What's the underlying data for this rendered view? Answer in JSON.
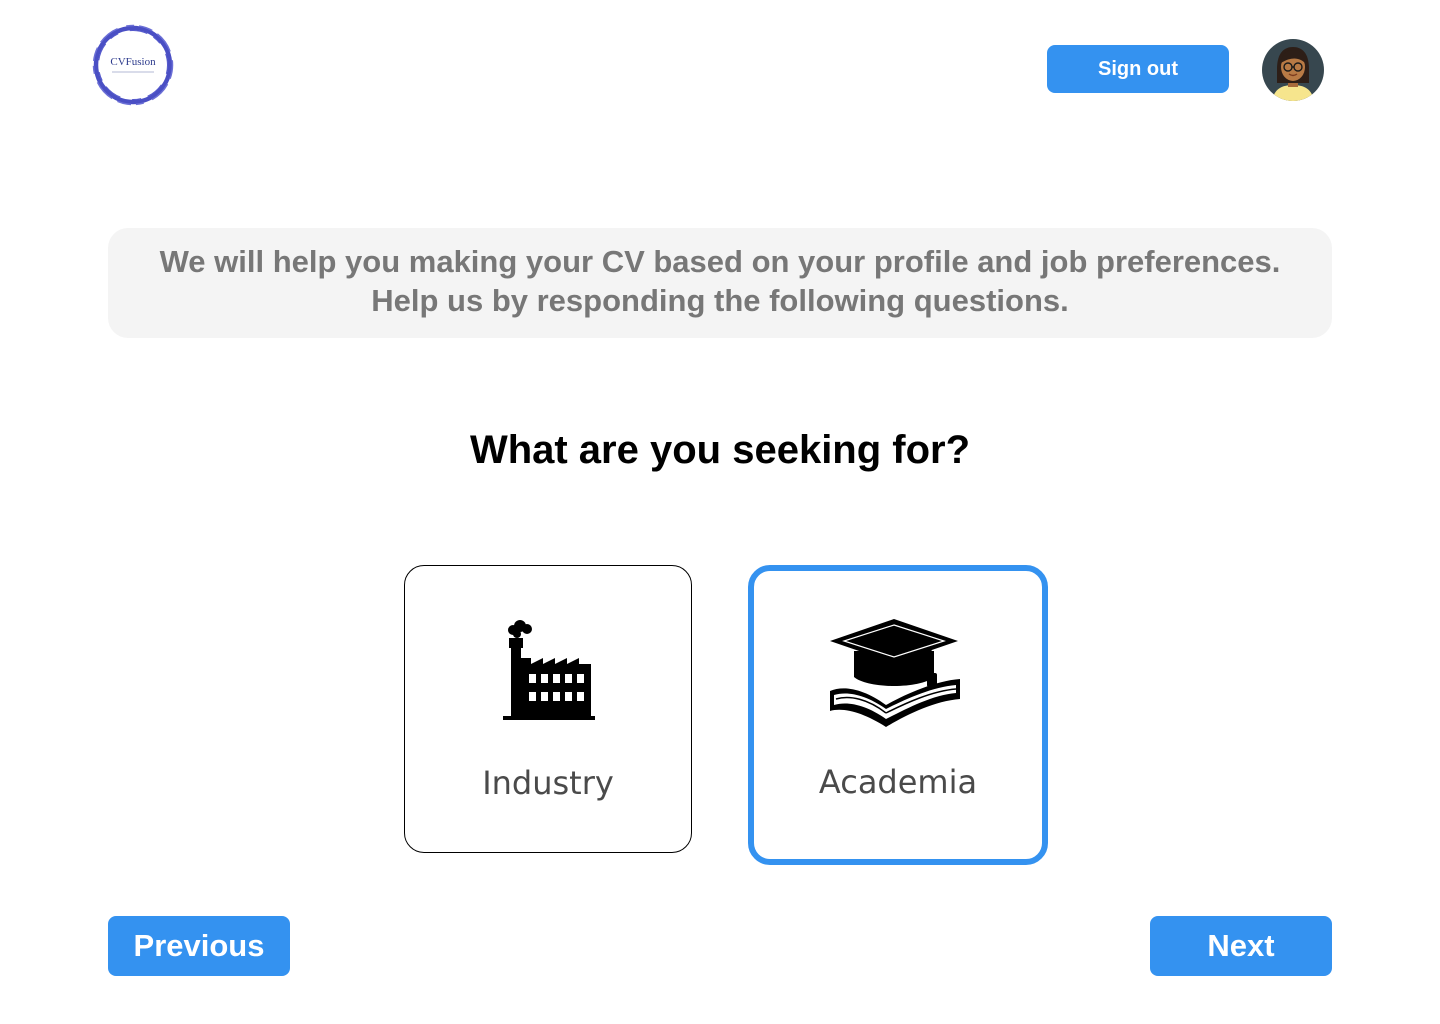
{
  "header": {
    "logo_text": "CVFusion",
    "signout_label": "Sign out"
  },
  "intro": {
    "line1": "We will help you making your CV based on your  profile and job preferences.",
    "line2": "Help us by responding the following questions."
  },
  "question": {
    "title": "What are you seeking for?"
  },
  "options": [
    {
      "label": "Industry",
      "icon": "factory-icon",
      "selected": false
    },
    {
      "label": "Academia",
      "icon": "graduation-cap-book-icon",
      "selected": true
    }
  ],
  "navigation": {
    "previous_label": "Previous",
    "next_label": "Next"
  },
  "colors": {
    "accent": "#3492f0",
    "banner_bg": "#f4f4f4",
    "banner_text": "#777777",
    "logo_ring": "#4a4fc4"
  }
}
